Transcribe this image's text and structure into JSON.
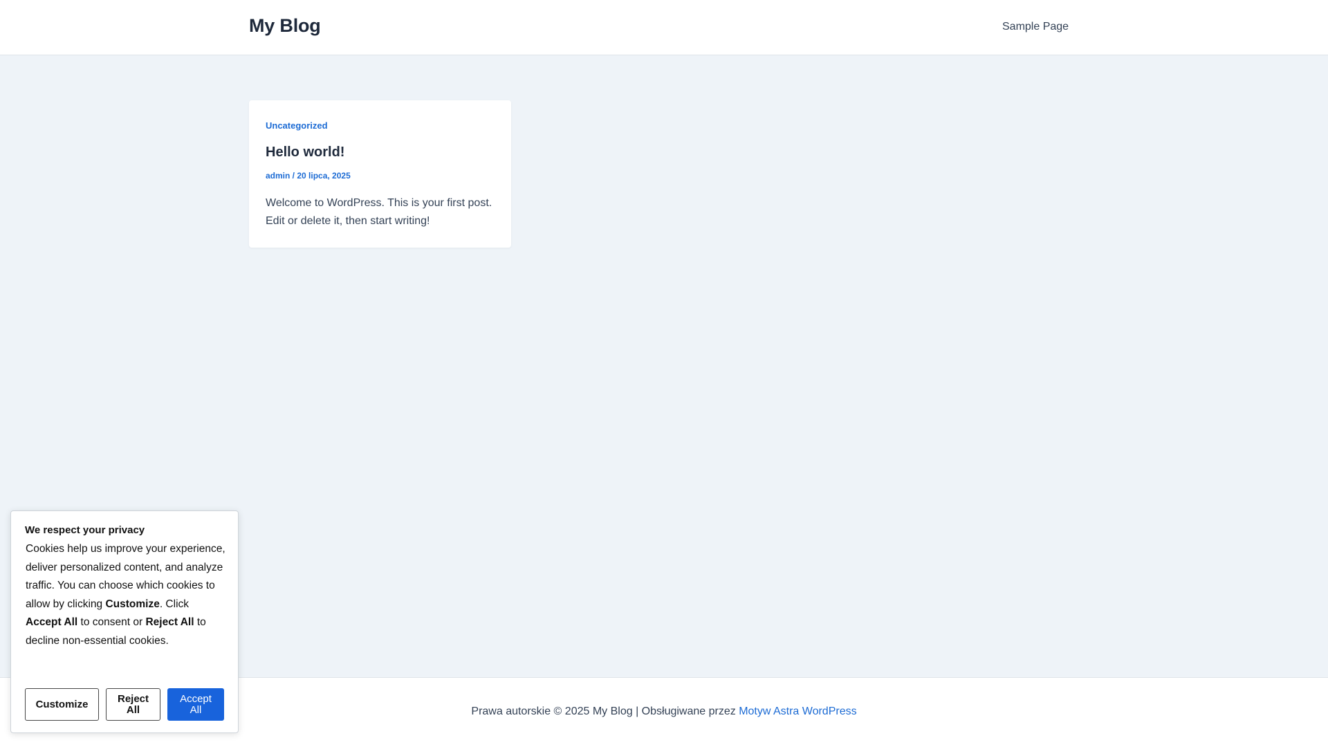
{
  "header": {
    "site_title": "My Blog",
    "nav": [
      {
        "label": "Sample Page"
      }
    ]
  },
  "post": {
    "category": "Uncategorized",
    "title": "Hello world!",
    "author": "admin",
    "separator": " / ",
    "date": "20 lipca, 2025",
    "excerpt": "Welcome to WordPress. This is your first post. Edit or delete it, then start writing!"
  },
  "footer": {
    "text": "Prawa autorskie © 2025 My Blog | Obsługiwane przez ",
    "link_label": "Motyw Astra WordPress"
  },
  "cookie_banner": {
    "title": "We respect your privacy",
    "desc_part1": "Cookies help us improve your experience, deliver personalized content, and analyze traffic. You can choose which cookies to allow by clicking ",
    "desc_bold1": "Customize",
    "desc_part2": ". Click ",
    "desc_bold2": "Accept All",
    "desc_part3": " to consent or ",
    "desc_bold3": "Reject All",
    "desc_part4": " to decline non-essential cookies.",
    "buttons": {
      "customize": "Customize",
      "reject": "Reject All",
      "accept": "Accept All"
    },
    "accent_color": "#1863dc"
  }
}
